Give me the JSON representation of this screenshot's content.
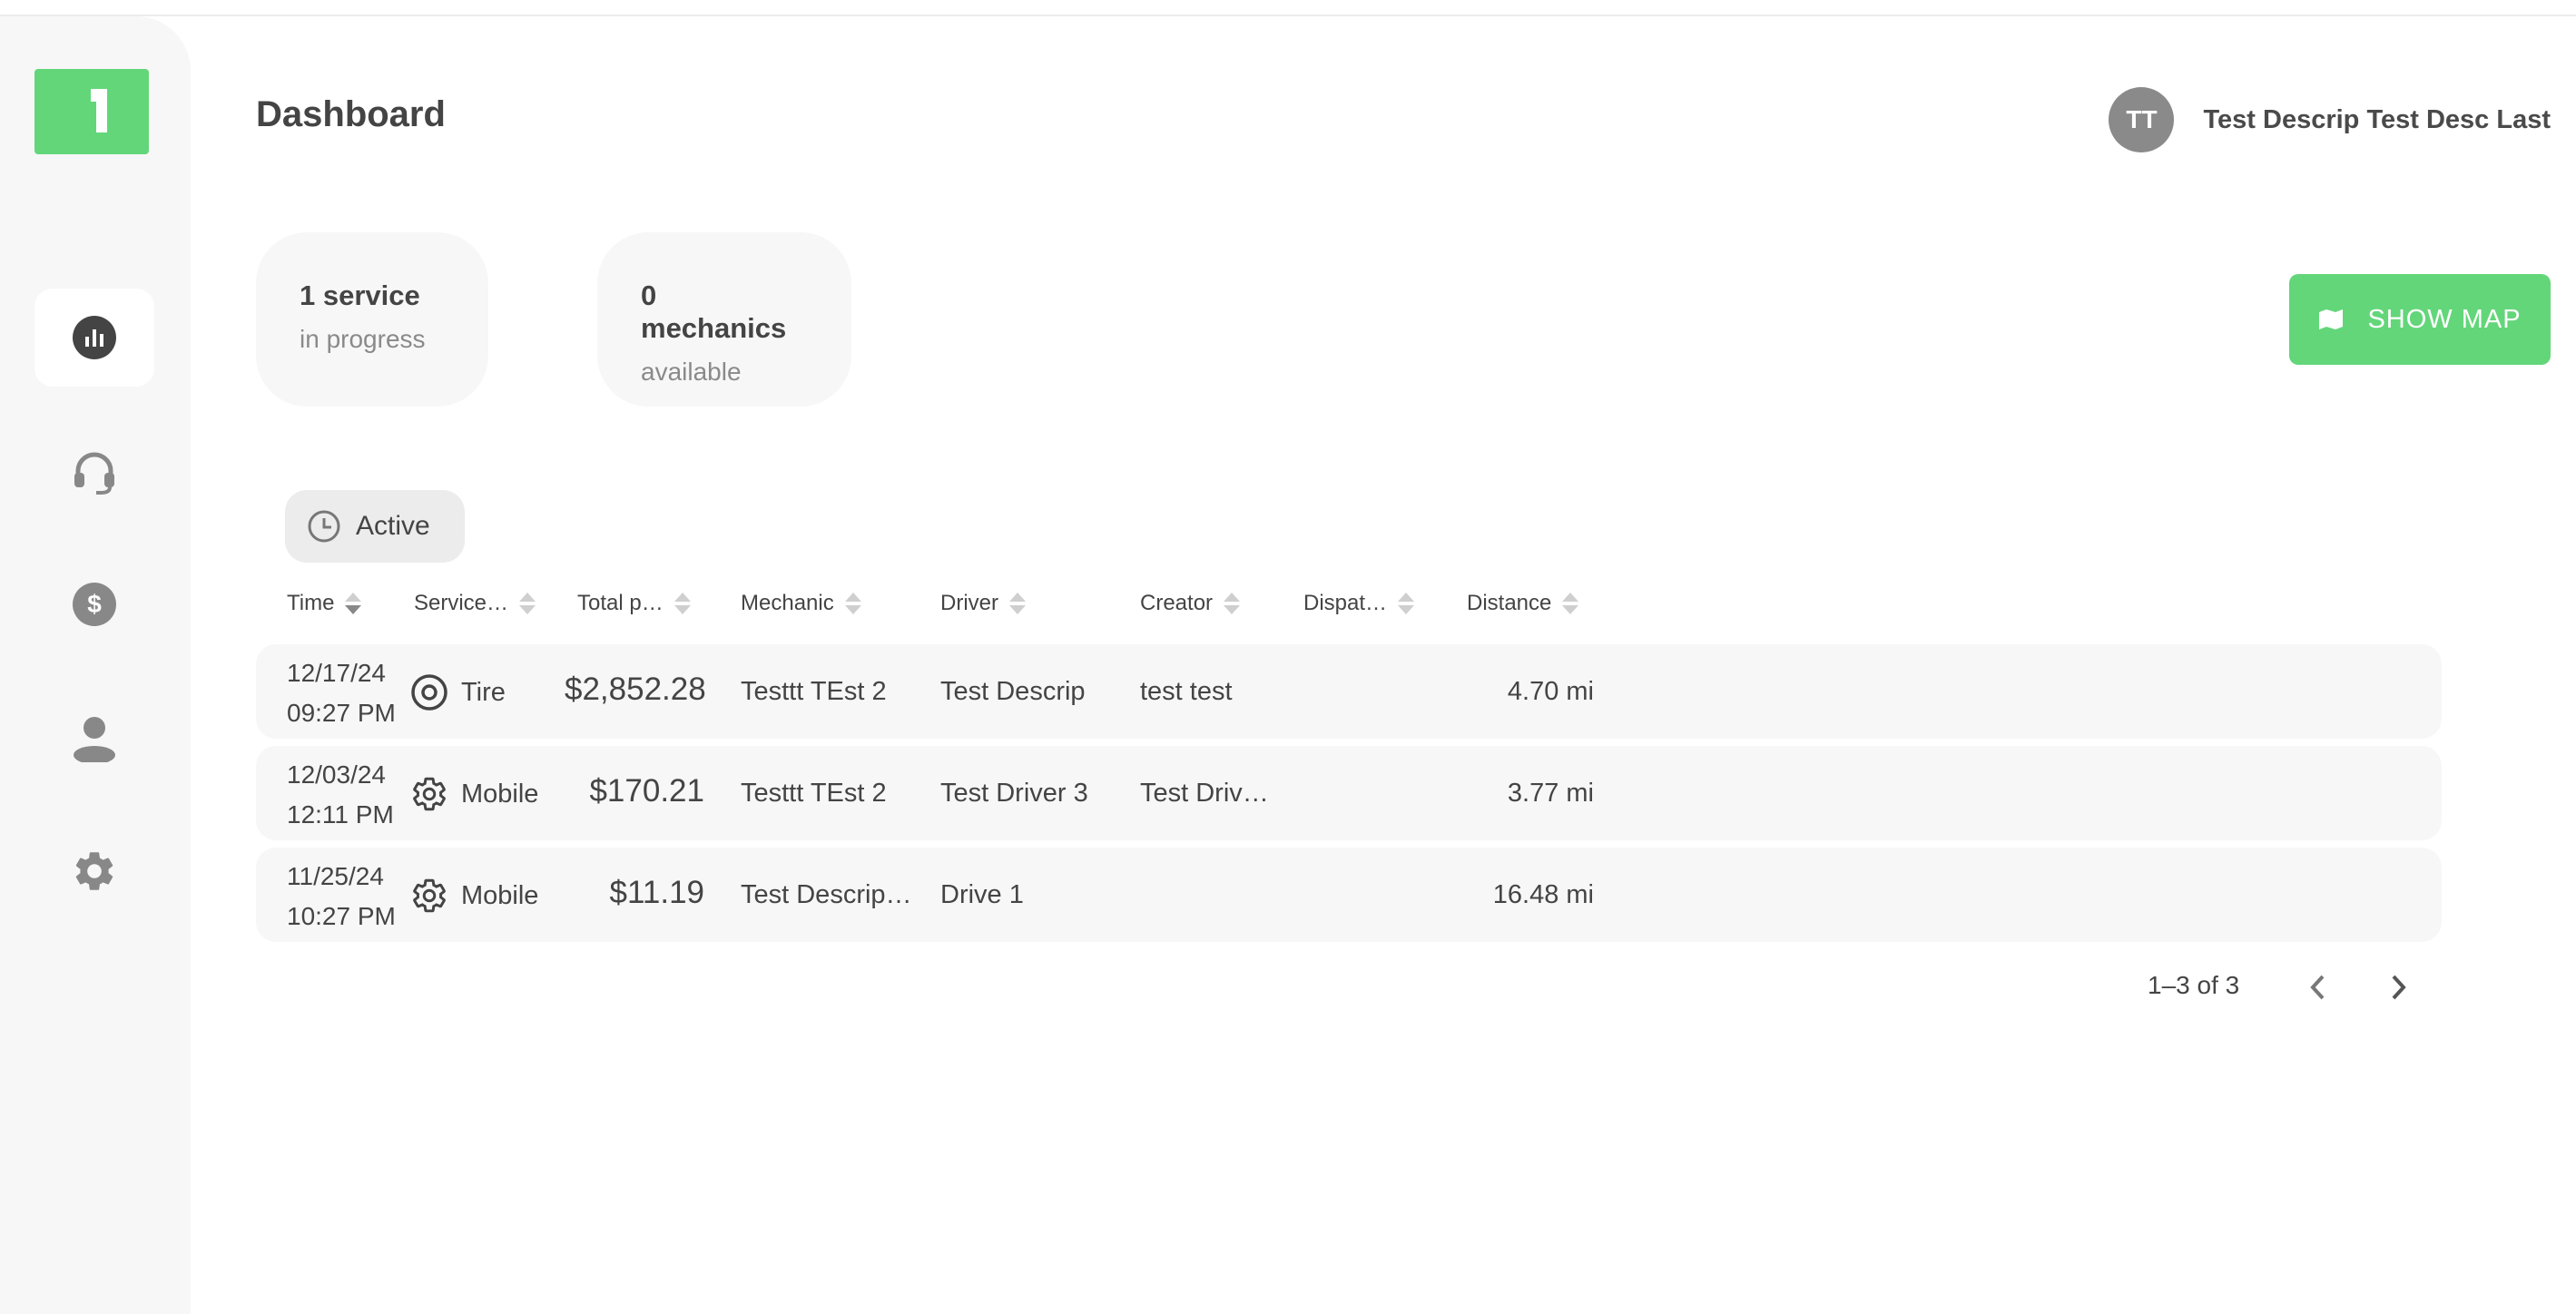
{
  "header": {
    "title": "Dashboard",
    "user": {
      "initials": "TT",
      "name": "Test Descrip Test Desc Last"
    }
  },
  "sidebar": {
    "items": [
      {
        "id": "dashboard",
        "icon": "bar-chart-icon",
        "active": true
      },
      {
        "id": "support",
        "icon": "headset-icon",
        "active": false
      },
      {
        "id": "billing",
        "icon": "dollar-icon",
        "active": false
      },
      {
        "id": "account",
        "icon": "person-icon",
        "active": false
      },
      {
        "id": "settings",
        "icon": "gear-icon",
        "active": false
      }
    ]
  },
  "stats": [
    {
      "value": "1 service",
      "label": "in progress"
    },
    {
      "value": "0 mechanics",
      "label": "available"
    }
  ],
  "show_map_label": "SHOW MAP",
  "filter": {
    "label": "Active",
    "icon": "clock-icon"
  },
  "table": {
    "columns": [
      "Time",
      "Service…",
      "Total p…",
      "Mechanic",
      "Driver",
      "Creator",
      "Dispat…",
      "Distance"
    ],
    "rows": [
      {
        "date": "12/17/24",
        "time": "09:27 PM",
        "service": "Tire",
        "service_icon": "tire-icon",
        "total": "$2,852.28",
        "mechanic": "Testtt TEst 2",
        "driver": "Test Descrip",
        "creator": "test test",
        "dispatcher": "",
        "distance": "4.70 mi"
      },
      {
        "date": "12/03/24",
        "time": "12:11 PM",
        "service": "Mobile",
        "service_icon": "gear-icon",
        "total": "$170.21",
        "mechanic": "Testtt TEst 2",
        "driver": "Test Driver 3",
        "creator": "Test Driv…",
        "dispatcher": "",
        "distance": "3.77 mi"
      },
      {
        "date": "11/25/24",
        "time": "10:27 PM",
        "service": "Mobile",
        "service_icon": "gear-icon",
        "total": "$11.19",
        "mechanic": "Test Descrip…",
        "driver": "Drive 1",
        "creator": "",
        "dispatcher": "",
        "distance": "16.48 mi"
      }
    ]
  },
  "pagination": {
    "label": "1–3 of 3"
  },
  "colors": {
    "accent": "#63d67a",
    "row_bg": "#f7f7f7",
    "sidebar_bg": "#f7f7f7",
    "avatar": "#8a8a8a"
  }
}
